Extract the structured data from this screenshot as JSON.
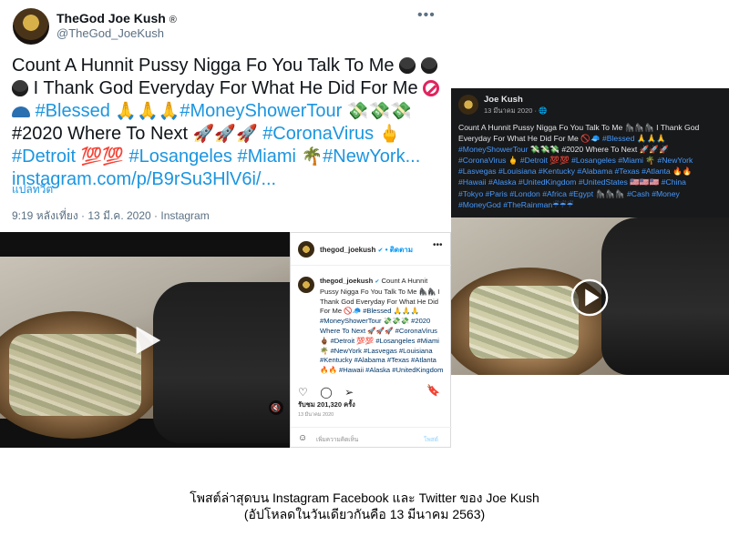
{
  "twitter": {
    "display_name": "TheGod Joe Kush",
    "registered_mark": "®",
    "handle": "@TheGod_JoeKush",
    "more": "•••",
    "text_1": "Count A Hunnit Pussy Nigga Fo You Talk To Me",
    "text_2": "I Thank God Everyday For What He Did For Me",
    "tag_blessed": "#Blessed",
    "tag_moneyshower": "#MoneyShowerTour",
    "text_3": "#2020 Where To Next",
    "tag_corona": "#CoronaVirus",
    "tag_detroit": "#Detroit",
    "tag_la": "#Losangeles",
    "tag_miami": "#Miami",
    "tag_newyork": "#NewYork...",
    "link": "instagram.com/p/B9rSu3HlV6i/...",
    "translate": "แปลทวีต",
    "meta": "9:19 หลังเที่ยง · 13 มี.ค. 2020 · Instagram"
  },
  "instagram": {
    "username": "thegod_joekush",
    "follow_label": "• ติดตาม",
    "more": "•••",
    "caption_user": "thegod_joekush",
    "caption_text": "Count A Hunnit Pussy Nigga Fo You Talk To Me 🦍🦍 I Thank God Everyday For What He Did For Me 🚫🧢",
    "caption_tags_1": "#Blessed 🙏🙏🙏 #MoneyShowerTour 💸💸💸 #2020 Where To Next 🚀🚀🚀 #CoronaVirus 🖕🏾 #Detroit 💯💯",
    "caption_tags_2": "#Losangeles #Miami 🌴 #NewYork #Lasvegas #Louisiana #Kentucky #Alabama #Texas #Atlanta 🔥🔥 #Hawaii #Alaska #UnitedKingdom #UnitedStates #China #Tokyo",
    "views": "รับชม 201,320 ครั้ง",
    "date": "13 มีนาคม 2020",
    "comment_placeholder": "เพิ่มความคิดเห็น",
    "post_label": "โพสต์"
  },
  "facebook": {
    "name": "Joe Kush",
    "date": "13 มีนาคม 2020 · 🌐",
    "text_plain_1": "Count A Hunnit Pussy Nigga Fo You Talk To Me 🦍🦍🦍 I Thank God Everyday For What He Did For Me 🚫🧢",
    "tag_blessed": "#Blessed",
    "emoji_pray": "🙏🙏🙏",
    "tag_moneyshower": "#MoneyShowerTour",
    "text_plain_2": "💸💸💸 #2020 Where To Next 🚀🚀🚀",
    "tags_line_1": "#CoronaVirus 🖕 #Detroit 💯💯 #Losangeles #Miami 🌴 #NewYork",
    "tags_line_2": "#Lasvegas #Louisiana #Kentucky #Alabama #Texas #Atlanta 🔥🔥",
    "tags_line_3": "#Hawaii #Alaska #UnitedKingdom #UnitedStates 🇺🇸🇺🇸🇺🇸 #China",
    "tags_line_4": "#Tokyo #Paris #London #Africa #Egypt 🦍🦍🦍 #Cash #Money",
    "tags_line_5": "#MoneyGod #TheRainman☔☔☔"
  },
  "caption": {
    "line_1": "โพสต์ล่าสุดบน Instagram Facebook และ Twitter ของ Joe Kush",
    "line_2": "(อัปโหลดในวันเดียวกันคือ 13 มีนาคม 2563)"
  },
  "colors": {
    "twitter_link": "#1b95e0",
    "facebook_dark": "#18191a",
    "facebook_link": "#4599ff",
    "instagram_blue": "#0095f6"
  }
}
